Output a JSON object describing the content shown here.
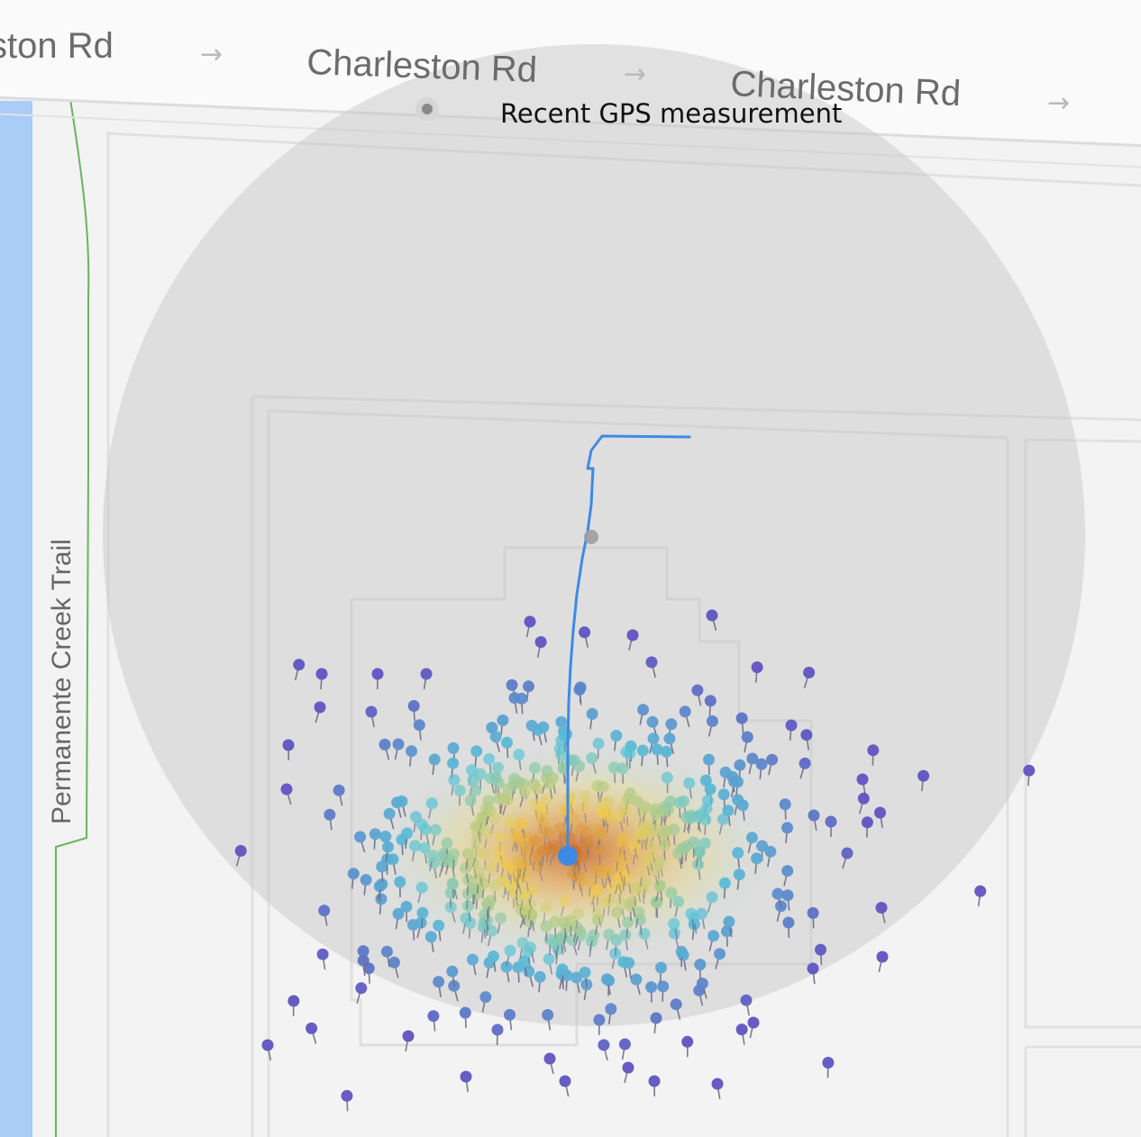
{
  "map": {
    "roads": {
      "top_road_labels": [
        "ston Rd",
        "Charleston Rd",
        "Charleston Rd"
      ],
      "trail_label": "Permanente Creek Trail",
      "direction_arrow_glyph": "→"
    },
    "annotation": {
      "label": "Recent GPS measurement"
    },
    "colors": {
      "background": "#f3f3f3",
      "road_fill": "#fafafa",
      "road_edge": "#dcdcdc",
      "creek": "#a9cdf7",
      "trail": "#67b45f",
      "accuracy_circle": "#c6c6c6",
      "track": "#3d8ae6",
      "pin_low": "#5c4fc1",
      "pin_mid": "#59c6d8",
      "pin_high": "#f2cf4b",
      "pin_peak": "#c8642b"
    },
    "icons": {
      "gps_dot": "gps-measurement-dot-icon",
      "current_location": "current-location-dot-icon",
      "pin": "map-pin-icon"
    }
  }
}
